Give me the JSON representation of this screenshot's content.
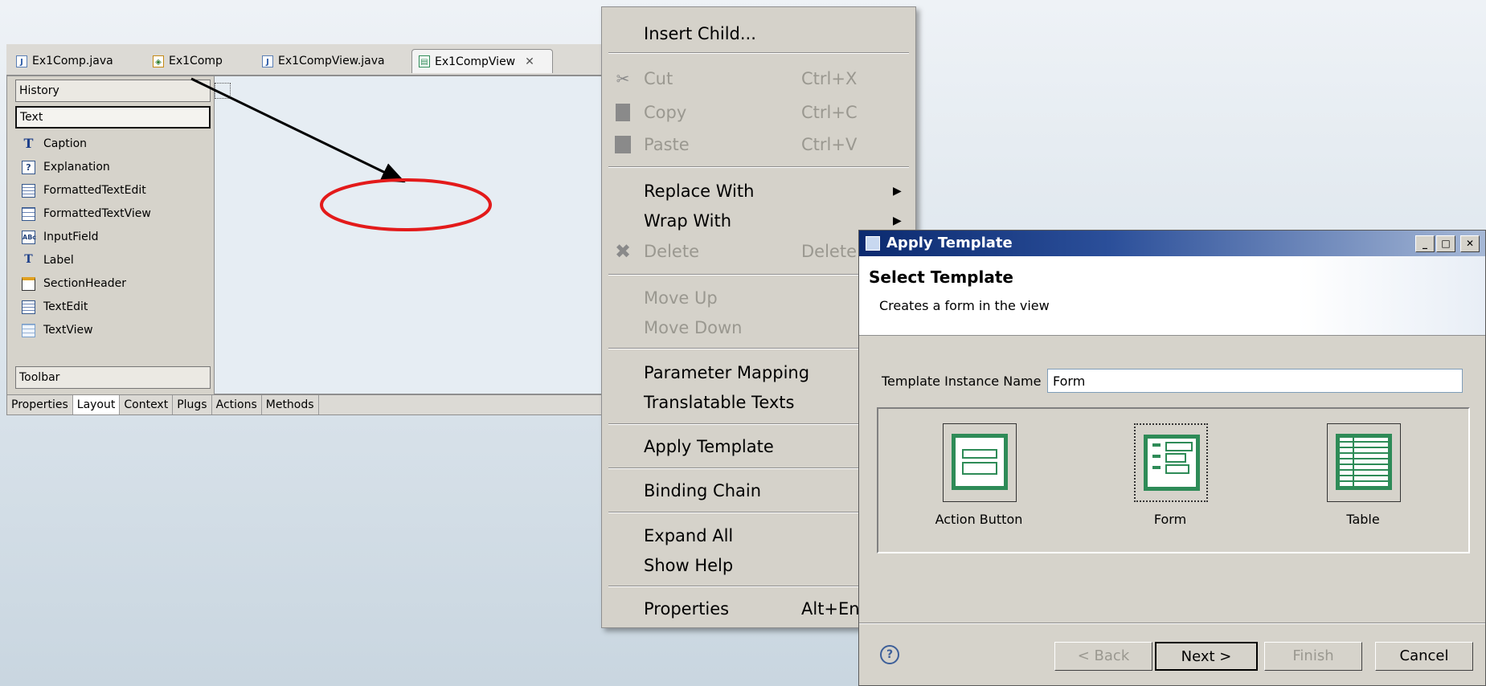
{
  "editor": {
    "tabs": [
      {
        "label": "Ex1Comp.java",
        "icon": "java-file-icon"
      },
      {
        "label": "Ex1Comp",
        "icon": "component-icon"
      },
      {
        "label": "Ex1CompView.java",
        "icon": "java-file-icon"
      },
      {
        "label": "Ex1CompView",
        "icon": "view-editor-icon",
        "active": true
      }
    ],
    "close_glyph": "✕",
    "palette": {
      "drawers": {
        "history": "History",
        "text": "Text",
        "toolbar": "Toolbar"
      },
      "items": [
        {
          "label": "Caption",
          "icon": "caption-icon",
          "glyph": "T"
        },
        {
          "label": "Explanation",
          "icon": "explanation-icon",
          "glyph": "?"
        },
        {
          "label": "FormattedTextEdit",
          "icon": "formatted-text-edit-icon",
          "glyph": ""
        },
        {
          "label": "FormattedTextView",
          "icon": "formatted-text-view-icon",
          "glyph": ""
        },
        {
          "label": "InputField",
          "icon": "input-field-icon",
          "glyph": "ABc"
        },
        {
          "label": "Label",
          "icon": "label-icon",
          "glyph": "T"
        },
        {
          "label": "SectionHeader",
          "icon": "section-header-icon",
          "glyph": ""
        },
        {
          "label": "TextEdit",
          "icon": "text-edit-icon",
          "glyph": ""
        },
        {
          "label": "TextView",
          "icon": "text-view-icon",
          "glyph": ""
        }
      ]
    },
    "bottom_tabs": [
      "Properties",
      "Layout",
      "Context",
      "Plugs",
      "Actions",
      "Methods"
    ],
    "active_bottom_tab": "Layout",
    "annotation_colors": {
      "arrow": "#000000",
      "ellipse": "#e31a1a"
    }
  },
  "context_menu": {
    "insert_child": "Insert Child...",
    "cut": "Cut",
    "cut_acc": "Ctrl+X",
    "copy": "Copy",
    "copy_acc": "Ctrl+C",
    "paste": "Paste",
    "paste_acc": "Ctrl+V",
    "replace_with": "Replace With",
    "wrap_with": "Wrap With",
    "delete": "Delete",
    "delete_acc": "Delete",
    "move_up": "Move Up",
    "move_down": "Move Down",
    "parameter_mapping": "Parameter Mapping",
    "translatable_texts": "Translatable Texts",
    "apply_template": "Apply Template",
    "binding_chain": "Binding Chain",
    "expand_all": "Expand All",
    "show_help": "Show Help",
    "properties": "Properties",
    "properties_acc": "Alt+En",
    "submenu_arrow": "▶"
  },
  "dialog": {
    "title": "Apply Template",
    "window_buttons": {
      "minimize": "_",
      "maximize": "□",
      "close": "✕"
    },
    "header_title": "Select Template",
    "header_desc": "Creates a form in the view",
    "name_label": "Template Instance Name",
    "name_value": "Form",
    "templates": [
      {
        "label": "Action Button",
        "selected": false
      },
      {
        "label": "Form",
        "selected": true
      },
      {
        "label": "Table",
        "selected": false
      }
    ],
    "help_glyph": "?",
    "buttons": {
      "back": "< Back",
      "next": "Next >",
      "finish": "Finish",
      "cancel": "Cancel"
    },
    "title_bar_color": "#0b2a6f",
    "template_icon_color": "#2e8b57"
  }
}
